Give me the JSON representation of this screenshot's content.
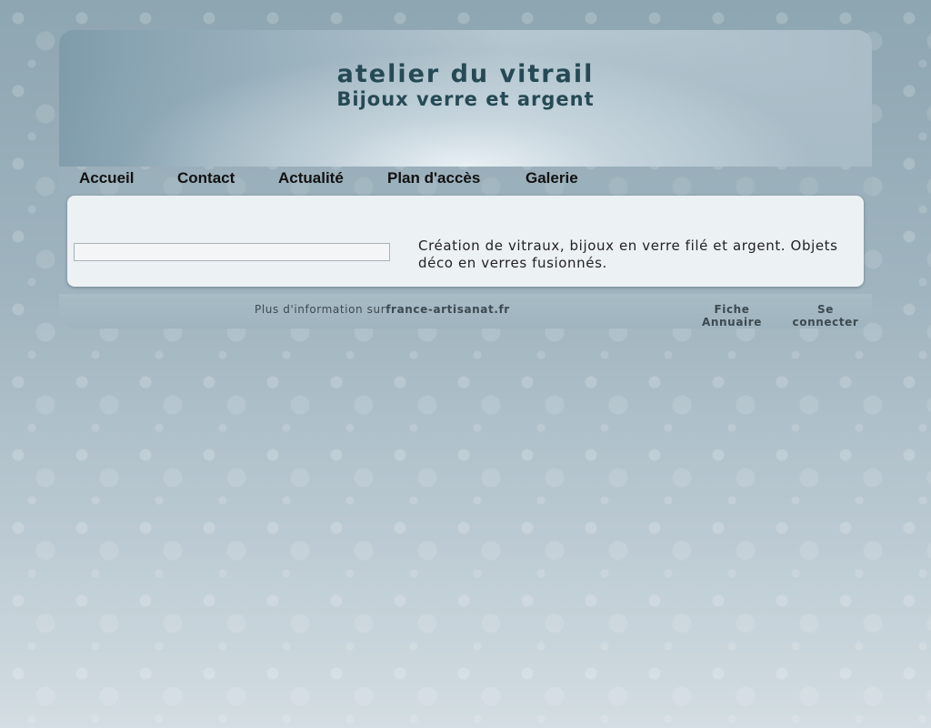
{
  "header": {
    "title": "atelier du vitrail",
    "subtitle": "Bijoux verre et argent"
  },
  "nav": {
    "items": [
      {
        "label": "Accueil"
      },
      {
        "label": "Contact"
      },
      {
        "label": "Actualité"
      },
      {
        "label": "Plan d'accès"
      },
      {
        "label": "Galerie"
      }
    ]
  },
  "content": {
    "search_value": "",
    "description": "Création de vitraux, bijoux en verre filé et argent. Objets déco en verres fusionnés."
  },
  "footer": {
    "info_prefix": "Plus d'information sur",
    "info_link": "france-artisanat.fr",
    "fiche_line1": "Fiche",
    "fiche_line2": "Annuaire",
    "login_line1": "Se",
    "login_line2": "connecter"
  },
  "colors": {
    "title": "#264a55",
    "content_bg": "#ecf1f4"
  }
}
